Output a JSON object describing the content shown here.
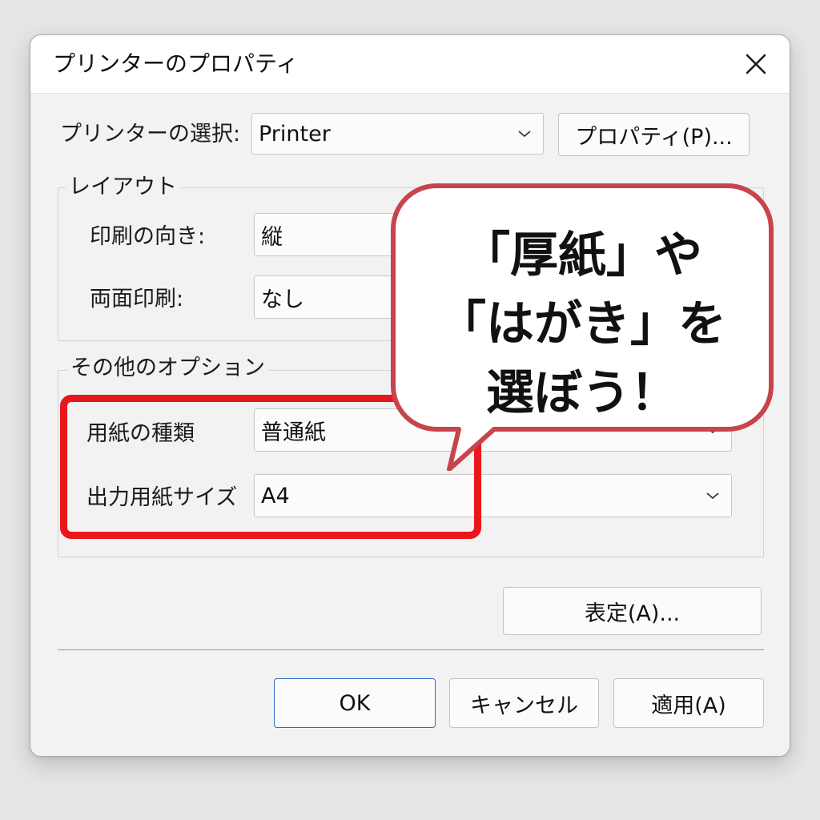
{
  "window": {
    "title": "プリンターのプロパティ",
    "close_icon": "close-icon"
  },
  "printer": {
    "label": "プリンターの選択:",
    "value": "Printer",
    "properties_button": "プロパティ(P)..."
  },
  "layout_group": {
    "title": "レイアウト",
    "orientation_label": "印刷の向き:",
    "orientation_value": "縦",
    "duplex_label": "両面印刷:",
    "duplex_value": "なし"
  },
  "options_group": {
    "title": "その他のオプション",
    "paper_type_label": "用紙の種類",
    "paper_type_value": "普通紙",
    "output_size_label": "出力用紙サイズ",
    "output_size_value": "A4"
  },
  "advanced_button": "表定(A)...",
  "footer": {
    "ok": "OK",
    "cancel": "キャンセル",
    "apply": "適用(A)"
  },
  "callout": {
    "line1": "「厚紙」や",
    "line2": "「はがき」を",
    "line3": "選ぼう！"
  },
  "colors": {
    "highlight": "#e8171c",
    "callout_border": "#c8444b",
    "ok_border": "#2a6fc4"
  }
}
